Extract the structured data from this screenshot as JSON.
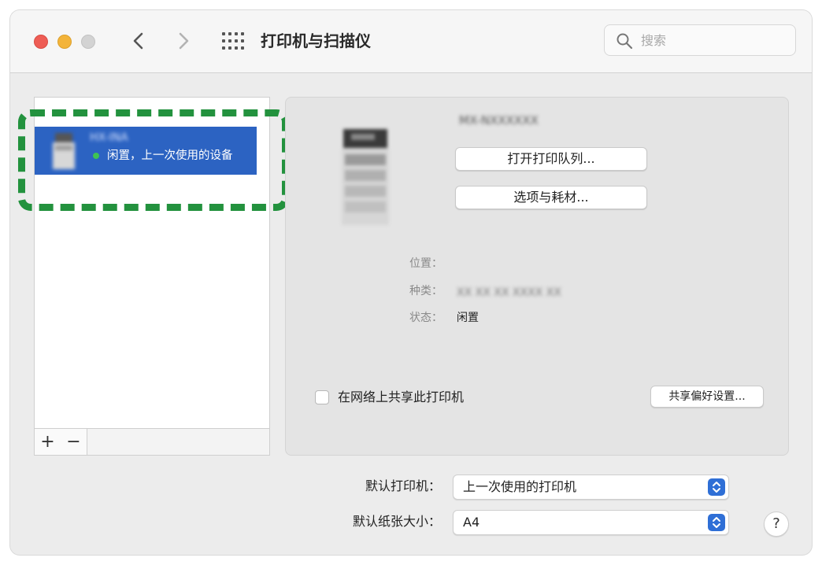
{
  "window": {
    "title": "打印机与扫描仪"
  },
  "search": {
    "placeholder": "搜索"
  },
  "printer_list": {
    "items": [
      {
        "name": "HX-INA",
        "status": "闲置，上一次使用的设备",
        "selected": true
      }
    ],
    "add_label": "+",
    "remove_label": "−"
  },
  "details": {
    "device_name": "MX-NXXXXXX",
    "buttons": {
      "open_queue": "打开打印队列...",
      "options_supplies": "选项与耗材..."
    },
    "labels": {
      "location": "位置：",
      "kind": "种类：",
      "status": "状态："
    },
    "values": {
      "location": "",
      "kind": "XX XX XX XXXX XX",
      "status": "闲置"
    },
    "share_checkbox_label": "在网络上共享此打印机",
    "share_checkbox_checked": false,
    "share_prefs_button": "共享偏好设置..."
  },
  "settings": {
    "default_printer_label": "默认打印机：",
    "default_printer_value": "上一次使用的打印机",
    "default_paper_label": "默认纸张大小：",
    "default_paper_value": "A4"
  },
  "help_label": "?",
  "colors": {
    "selection": "#2c63c2",
    "highlight_frame": "#23923e",
    "status_idle": "#3ec353",
    "popup_arrow": "#2f6fd6"
  }
}
